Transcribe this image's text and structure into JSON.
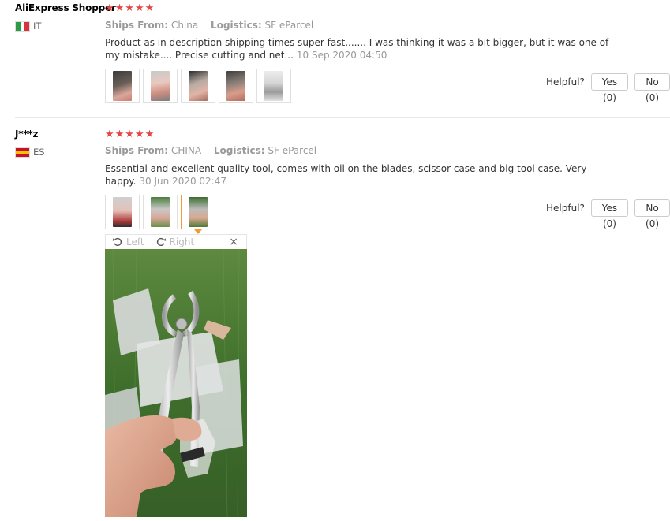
{
  "reviews": [
    {
      "user": "AliExpress Shopper",
      "country": "IT",
      "stars": "★★★★★",
      "ships_label": "Ships From:",
      "ships_value": "China",
      "logistics_label": "Logistics:",
      "logistics_value": "SF eParcel",
      "text": "Product as in description shipping times super fast....... I was thinking it was a bit bigger, but it was one of my mistake.... Precise cutting and net...",
      "date": "10 Sep 2020 04:50",
      "helpful_label": "Helpful?",
      "yes_label": "Yes (0)",
      "no_label": "No (0)"
    },
    {
      "user": "J***z",
      "country": "ES",
      "stars": "★★★★★",
      "ships_label": "Ships From:",
      "ships_value": "CHINA",
      "logistics_label": "Logistics:",
      "logistics_value": "SF eParcel",
      "text": "Essential and excellent quality tool, comes with oil on the blades, scissor case and big tool case. Very happy.",
      "date": "30 Jun 2020 02:47",
      "helpful_label": "Helpful?",
      "yes_label": "Yes (0)",
      "no_label": "No (0)"
    }
  ],
  "viewer": {
    "rotate_left_label": "Left",
    "rotate_right_label": "Right",
    "close_label": "×"
  },
  "icons": {
    "rotate_left": "rotate-left-icon",
    "rotate_right": "rotate-right-icon",
    "close": "close-icon"
  },
  "colors": {
    "stars": "#e64545",
    "active_thumb_border": "#f39a36",
    "muted_text": "#999999"
  }
}
